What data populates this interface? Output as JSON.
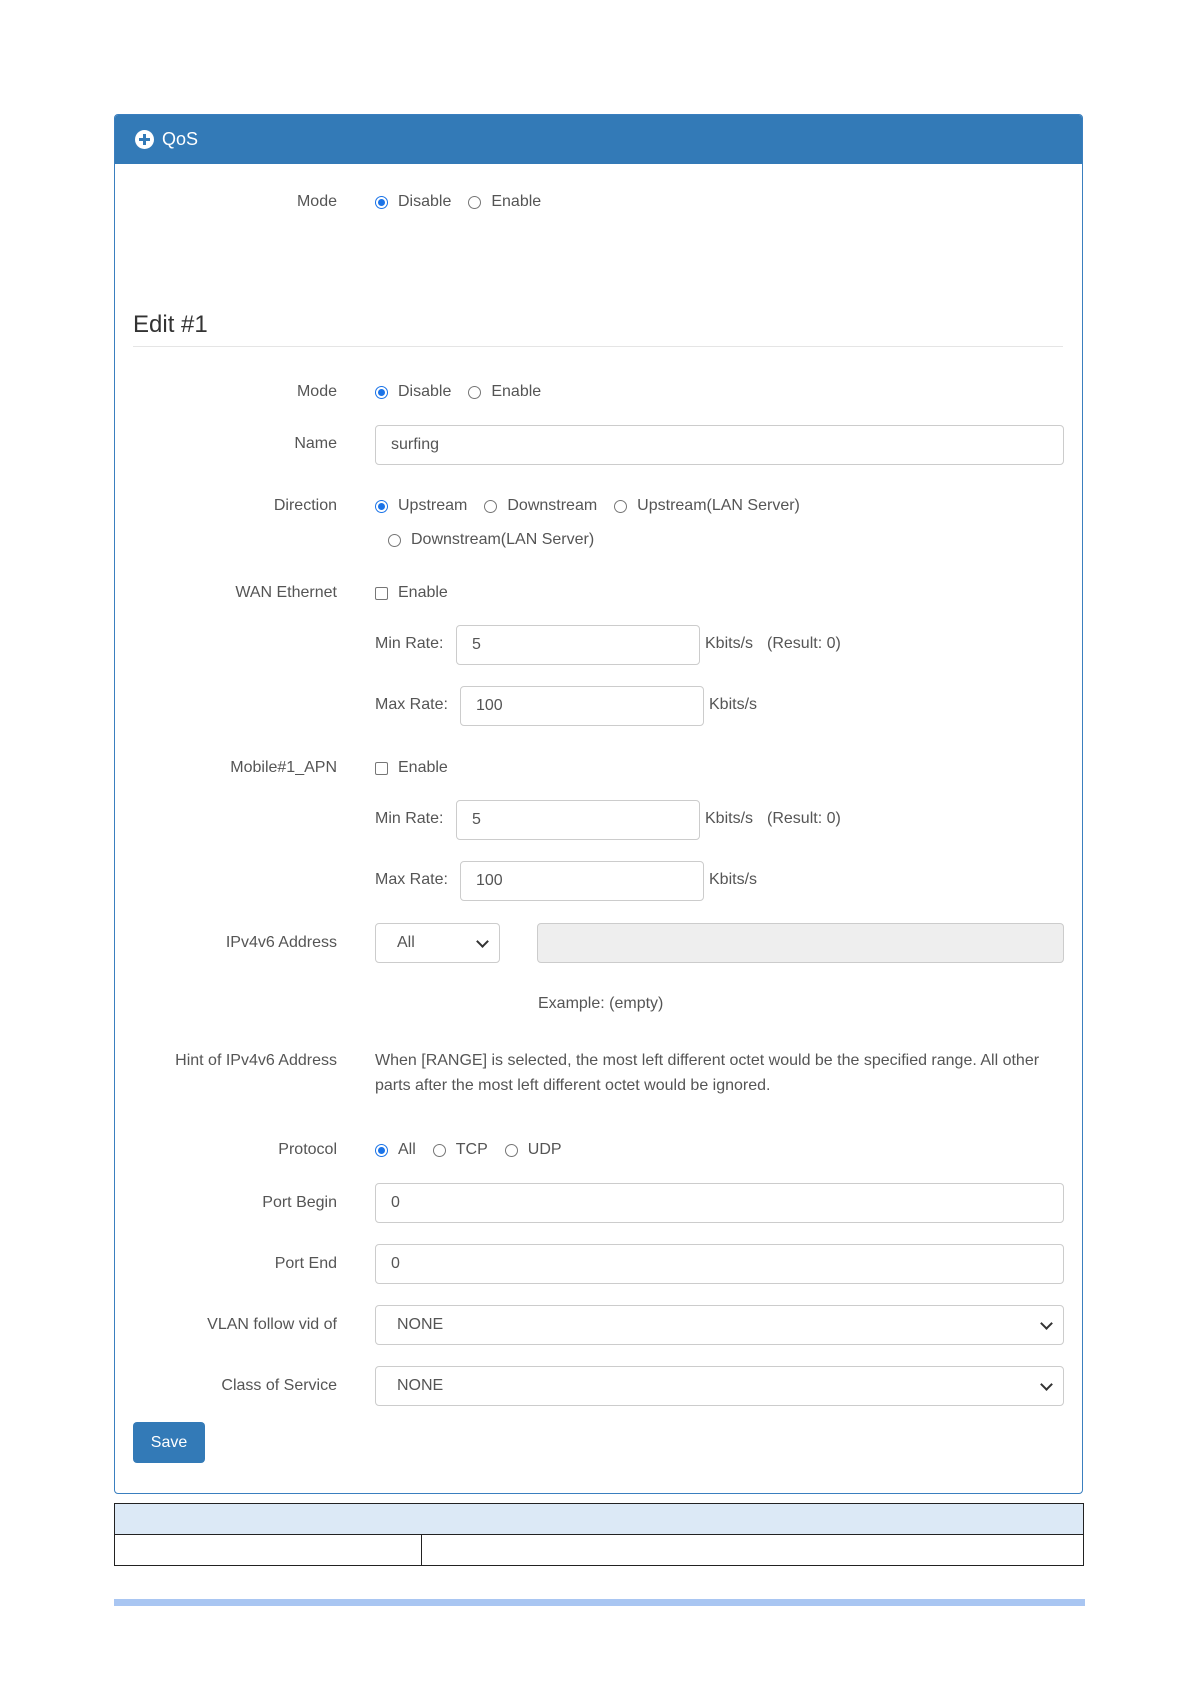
{
  "panel": {
    "title": "QoS"
  },
  "global_mode": {
    "label": "Mode",
    "options": [
      "Disable",
      "Enable"
    ],
    "selected": "Disable"
  },
  "edit": {
    "title": "Edit #1",
    "mode": {
      "label": "Mode",
      "options": [
        "Disable",
        "Enable"
      ],
      "selected": "Disable"
    },
    "name": {
      "label": "Name",
      "value": "surfing"
    },
    "direction": {
      "label": "Direction",
      "options": [
        "Upstream",
        "Downstream",
        "Upstream(LAN Server)",
        "Downstream(LAN Server)"
      ],
      "selected": "Upstream"
    },
    "wan": {
      "label": "WAN Ethernet",
      "enable_label": "Enable",
      "min_label": "Min Rate:",
      "min_value": "5",
      "min_unit": "Kbits/s",
      "min_result": "(Result: 0)",
      "max_label": "Max Rate:",
      "max_value": "100",
      "max_unit": "Kbits/s"
    },
    "mobile": {
      "label": "Mobile#1_APN",
      "enable_label": "Enable",
      "min_label": "Min Rate:",
      "min_value": "5",
      "min_unit": "Kbits/s",
      "min_result": "(Result: 0)",
      "max_label": "Max Rate:",
      "max_value": "100",
      "max_unit": "Kbits/s"
    },
    "ip": {
      "label": "IPv4v6 Address",
      "select_value": "All",
      "example": "Example: (empty)"
    },
    "hint": {
      "label": "Hint of IPv4v6 Address",
      "text": "When [RANGE] is selected, the most left different octet would be the specified range. All other parts after the most left different octet would be ignored."
    },
    "protocol": {
      "label": "Protocol",
      "options": [
        "All",
        "TCP",
        "UDP"
      ],
      "selected": "All"
    },
    "port_begin": {
      "label": "Port Begin",
      "value": "0"
    },
    "port_end": {
      "label": "Port End",
      "value": "0"
    },
    "vlan": {
      "label": "VLAN follow vid of",
      "value": "NONE"
    },
    "cos": {
      "label": "Class of Service",
      "value": "NONE"
    },
    "save_label": "Save"
  }
}
